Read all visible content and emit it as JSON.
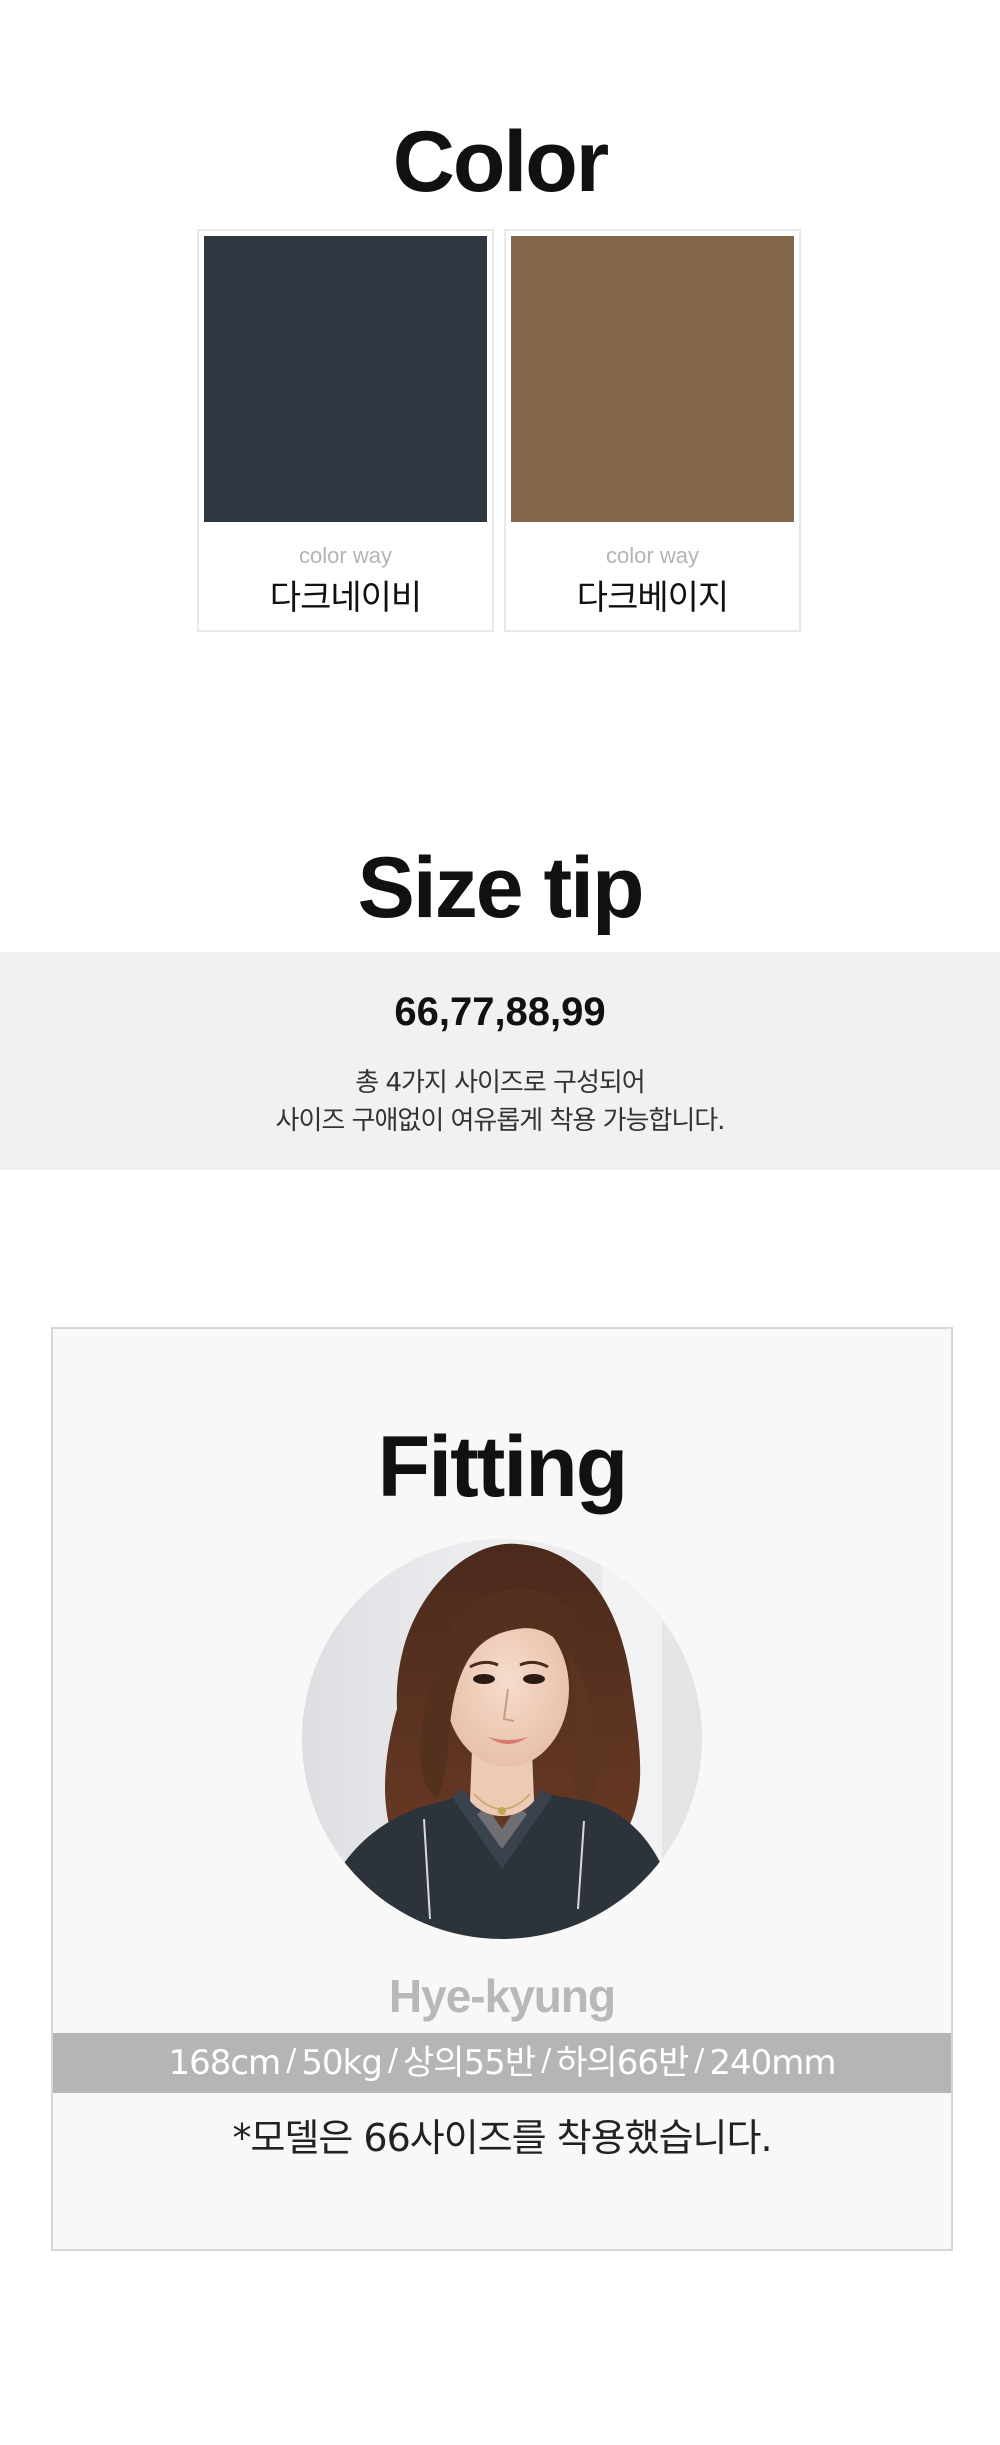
{
  "color_section": {
    "title": "Color",
    "swatches": [
      {
        "sub_label": "color way",
        "name": "다크네이비",
        "hex": "#2e3642"
      },
      {
        "sub_label": "color way",
        "name": "다크베이지",
        "hex": "#82664a"
      }
    ]
  },
  "size_section": {
    "title": "Size tip",
    "sizes": "66,77,88,99",
    "description_line1": "총 4가지 사이즈로 구성되어",
    "description_line2": "사이즈 구애없이 여유롭게 착용 가능합니다."
  },
  "fitting_section": {
    "title": "Fitting",
    "model_name": "Hye-kyung",
    "specs": [
      "168cm",
      "50kg",
      "상의55반",
      "하의66반",
      "240mm"
    ],
    "separator": "/",
    "note": "*모델은 66사이즈를 착용했습니다."
  },
  "colors": {
    "band_background": "#f1f1f1",
    "spec_bar": "#b5b5b5",
    "fitting_background": "#f8f8f8"
  }
}
